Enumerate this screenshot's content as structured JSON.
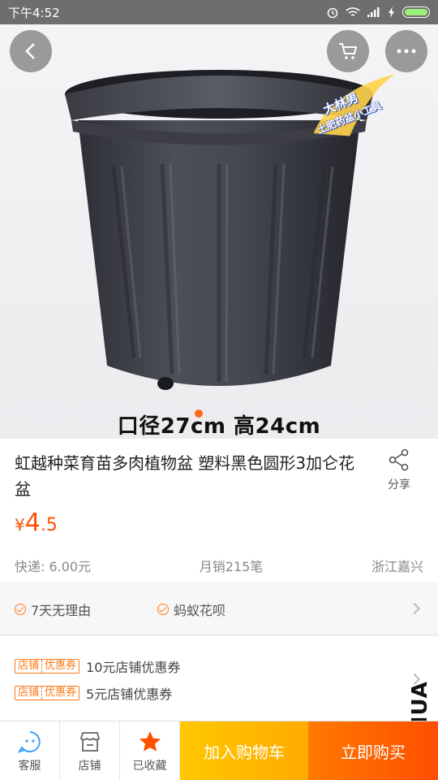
{
  "status_bar": {
    "time": "下午4:52"
  },
  "product_image": {
    "caption": "口径27cm 高24cm",
    "watermark_line1": "大林男",
    "watermark_line2": "土肥药盆小工具"
  },
  "product": {
    "title": "虹越种菜育苗多肉植物盆 塑料黑色圆形3加仑花盆",
    "share_label": "分享",
    "price_currency": "¥",
    "price_integer": "4",
    "price_decimal": ".5",
    "shipping": "快递: 6.00元",
    "monthly_sales": "月销215笔",
    "location": "浙江嘉兴"
  },
  "services": [
    {
      "label": "7天无理由"
    },
    {
      "label": "蚂蚁花呗"
    }
  ],
  "coupons": [
    {
      "tag_left": "店铺",
      "tag_right": "优惠券",
      "text": "10元店铺优惠券"
    },
    {
      "tag_left": "店铺",
      "tag_right": "优惠券",
      "text": "5元店铺优惠券"
    }
  ],
  "side_watermark": "MSHUA",
  "bottom_bar": {
    "service_label": "客服",
    "shop_label": "店铺",
    "favorite_label": "已收藏",
    "add_to_cart_label": "加入购物车",
    "buy_now_label": "立即购买"
  },
  "colors": {
    "accent": "#ff5000",
    "cart": "#ffb400",
    "buy": "#ff5a00"
  },
  "icons": [
    "back-icon",
    "cart-icon",
    "more-icon",
    "share-icon",
    "customer-service-icon",
    "shop-icon",
    "star-icon",
    "chevron-right-icon",
    "check-circle-icon"
  ]
}
